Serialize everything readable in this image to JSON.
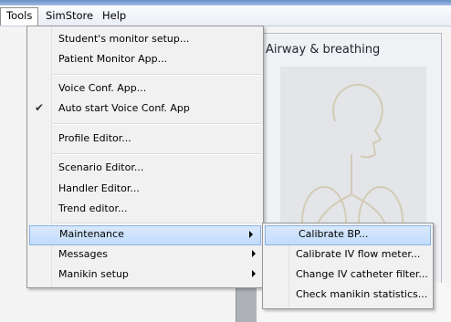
{
  "menubar": {
    "items": [
      {
        "label": "Tools"
      },
      {
        "label": "SimStore"
      },
      {
        "label": "Help"
      }
    ]
  },
  "tools_menu": {
    "items": [
      {
        "label": "Student's monitor setup..."
      },
      {
        "label": "Patient Monitor App..."
      },
      {
        "label": "Voice Conf. App..."
      },
      {
        "label": "Auto start Voice Conf. App",
        "checked": true
      },
      {
        "label": "Profile Editor..."
      },
      {
        "label": "Scenario Editor..."
      },
      {
        "label": "Handler Editor..."
      },
      {
        "label": "Trend editor..."
      },
      {
        "label": "Maintenance",
        "submenu": true,
        "highlighted": true
      },
      {
        "label": "Messages",
        "submenu": true
      },
      {
        "label": "Manikin setup",
        "submenu": true
      }
    ],
    "check_icon": "checkmark-icon"
  },
  "maintenance_menu": {
    "items": [
      {
        "label": "Calibrate BP...",
        "highlighted": true
      },
      {
        "label": "Calibrate IV flow meter..."
      },
      {
        "label": "Change IV catheter filter..."
      },
      {
        "label": "Check manikin statistics..."
      }
    ]
  },
  "panel": {
    "title": "Airway & breathing"
  },
  "colors": {
    "highlight": "#c1dcfc",
    "highlight_border": "#8ab3e6",
    "menu_bg": "#f1f1f1"
  }
}
